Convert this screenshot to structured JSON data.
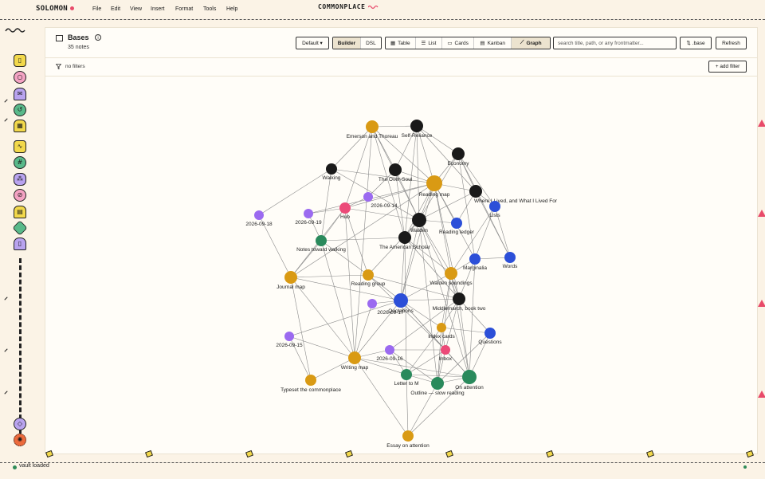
{
  "app": {
    "brand": "SOLOMON",
    "title": "COMMONPLACE",
    "menu": [
      "File",
      "Edit",
      "View",
      "Insert",
      "Format",
      "Tools",
      "Help"
    ]
  },
  "rail": {
    "icons": [
      "note-icon",
      "search-icon",
      "inbox-icon",
      "history-icon",
      "calendar-icon",
      "activity-icon",
      "grid-icon",
      "graph-icon",
      "tag-icon",
      "archive-icon",
      "label-icon",
      "book-icon",
      "shield-icon",
      "settings-icon"
    ]
  },
  "header": {
    "title": "Bases",
    "subtitle": "35 notes",
    "view_select": "Default ▾",
    "modes": [
      "Builder",
      "DSL"
    ],
    "views": [
      "Table",
      "List",
      "Cards",
      "Kanban",
      "Graph"
    ],
    "search_placeholder": "search title, path, or any frontmatter...",
    "base_button": "⇅ .base",
    "refresh_button": "Refresh"
  },
  "filter": {
    "label": "no filters",
    "add_label": "+ add filter"
  },
  "status": {
    "text": "vault loaded"
  },
  "colors": {
    "black": "#1a1a1a",
    "orange": "#d99a14",
    "blue": "#2c4fd8",
    "green": "#2a8a5c",
    "purple": "#9b6af0",
    "pink": "#ec4a78",
    "accent": "#e84a6a"
  },
  "graph": {
    "nodes": [
      {
        "id": "emerson",
        "label": "Emerson and Thoreau",
        "type": "orange"
      },
      {
        "id": "selfreliance",
        "label": "Self-Reliance",
        "type": "black"
      },
      {
        "id": "economy",
        "label": "Economy",
        "type": "black"
      },
      {
        "id": "walking",
        "label": "Walking",
        "type": "black"
      },
      {
        "id": "overSoul",
        "label": "The Over-Soul",
        "type": "black"
      },
      {
        "id": "readingmap",
        "label": "Reading map",
        "type": "orange"
      },
      {
        "id": "where",
        "label": "Where I Lived, and What I Lived For",
        "type": "black"
      },
      {
        "id": "d0914",
        "label": "2026-09-14",
        "type": "purple"
      },
      {
        "id": "hub",
        "label": "Hub",
        "type": "pink"
      },
      {
        "id": "d0919",
        "label": "2026-09-19",
        "type": "purple"
      },
      {
        "id": "d0918",
        "label": "2026-09-18",
        "type": "purple"
      },
      {
        "id": "lists",
        "label": "Lists",
        "type": "blue"
      },
      {
        "id": "walden",
        "label": "Walden",
        "type": "black"
      },
      {
        "id": "readingledger",
        "label": "Reading ledger",
        "type": "blue"
      },
      {
        "id": "americanscholar",
        "label": "The American Scholar",
        "type": "black"
      },
      {
        "id": "notestoward",
        "label": "Notes toward walking",
        "type": "green"
      },
      {
        "id": "marginalia",
        "label": "Marginalia",
        "type": "blue"
      },
      {
        "id": "words",
        "label": "Words",
        "type": "blue"
      },
      {
        "id": "journalmap",
        "label": "Journal map",
        "type": "orange"
      },
      {
        "id": "readinggroup",
        "label": "Reading group",
        "type": "orange"
      },
      {
        "id": "waldensoundings",
        "label": "Walden soundings",
        "type": "orange"
      },
      {
        "id": "middlemarch",
        "label": "Middlemarch, book two",
        "type": "black"
      },
      {
        "id": "d0917",
        "label": "2026-09-17",
        "type": "purple"
      },
      {
        "id": "quotations",
        "label": "Quotations",
        "type": "blue"
      },
      {
        "id": "indexcards",
        "label": "Index cards",
        "type": "orange"
      },
      {
        "id": "questions",
        "label": "Questions",
        "type": "blue"
      },
      {
        "id": "d0915",
        "label": "2026-09-15",
        "type": "purple"
      },
      {
        "id": "inbox",
        "label": "Inbox",
        "type": "pink"
      },
      {
        "id": "writingmap",
        "label": "Writing map",
        "type": "orange"
      },
      {
        "id": "d0916",
        "label": "2026-09-16",
        "type": "purple"
      },
      {
        "id": "letterto",
        "label": "Letter to M",
        "type": "green"
      },
      {
        "id": "onattention",
        "label": "On attention",
        "type": "green"
      },
      {
        "id": "outline",
        "label": "Outline — slow reading",
        "type": "green"
      },
      {
        "id": "typeset",
        "label": "Typeset the commonplace",
        "type": "orange"
      },
      {
        "id": "essay",
        "label": "Essay on attention",
        "type": "orange"
      }
    ],
    "edges": [
      [
        "emerson",
        "selfreliance"
      ],
      [
        "emerson",
        "walking"
      ],
      [
        "emerson",
        "overSoul"
      ],
      [
        "emerson",
        "readingmap"
      ],
      [
        "emerson",
        "walden"
      ],
      [
        "emerson",
        "americanscholar"
      ],
      [
        "emerson",
        "writingmap"
      ],
      [
        "emerson",
        "hub"
      ],
      [
        "selfreliance",
        "economy"
      ],
      [
        "selfreliance",
        "overSoul"
      ],
      [
        "selfreliance",
        "readingmap"
      ],
      [
        "selfreliance",
        "walden"
      ],
      [
        "selfreliance",
        "where"
      ],
      [
        "selfreliance",
        "americanscholar"
      ],
      [
        "economy",
        "readingmap"
      ],
      [
        "economy",
        "where"
      ],
      [
        "economy",
        "lists"
      ],
      [
        "economy",
        "walden"
      ],
      [
        "economy",
        "marginalia"
      ],
      [
        "economy",
        "words"
      ],
      [
        "walking",
        "notestoward"
      ],
      [
        "walking",
        "readingmap"
      ],
      [
        "walking",
        "d0918"
      ],
      [
        "walking",
        "walden"
      ],
      [
        "overSoul",
        "readingmap"
      ],
      [
        "overSoul",
        "walden"
      ],
      [
        "overSoul",
        "americanscholar"
      ],
      [
        "overSoul",
        "d0914"
      ],
      [
        "readingmap",
        "where"
      ],
      [
        "readingmap",
        "walden"
      ],
      [
        "readingmap",
        "americanscholar"
      ],
      [
        "readingmap",
        "readingledger"
      ],
      [
        "readingmap",
        "marginalia"
      ],
      [
        "readingmap",
        "waldensoundings"
      ],
      [
        "readingmap",
        "middlemarch"
      ],
      [
        "readingmap",
        "journalmap"
      ],
      [
        "readingmap",
        "d0919"
      ],
      [
        "readingmap",
        "hub"
      ],
      [
        "readingmap",
        "quotations"
      ],
      [
        "where",
        "walden"
      ],
      [
        "where",
        "lists"
      ],
      [
        "where",
        "readingledger"
      ],
      [
        "where",
        "words"
      ],
      [
        "hub",
        "d0919"
      ],
      [
        "hub",
        "d0914"
      ],
      [
        "hub",
        "notestoward"
      ],
      [
        "hub",
        "journalmap"
      ],
      [
        "hub",
        "readinggroup"
      ],
      [
        "hub",
        "writingmap"
      ],
      [
        "hub",
        "walden"
      ],
      [
        "d0918",
        "journalmap"
      ],
      [
        "d0919",
        "notestoward"
      ],
      [
        "walden",
        "americanscholar"
      ],
      [
        "walden",
        "readingledger"
      ],
      [
        "walden",
        "waldensoundings"
      ],
      [
        "walden",
        "quotations"
      ],
      [
        "walden",
        "middlemarch"
      ],
      [
        "walden",
        "readinggroup"
      ],
      [
        "walden",
        "onattention"
      ],
      [
        "walden",
        "outline"
      ],
      [
        "americanscholar",
        "notestoward"
      ],
      [
        "americanscholar",
        "quotations"
      ],
      [
        "americanscholar",
        "waldensoundings"
      ],
      [
        "americanscholar",
        "middlemarch"
      ],
      [
        "americanscholar",
        "letterto"
      ],
      [
        "notestoward",
        "journalmap"
      ],
      [
        "notestoward",
        "writingmap"
      ],
      [
        "notestoward",
        "readinggroup"
      ],
      [
        "marginalia",
        "words"
      ],
      [
        "marginalia",
        "lists"
      ],
      [
        "marginalia",
        "waldensoundings"
      ],
      [
        "marginalia",
        "middlemarch"
      ],
      [
        "marginalia",
        "onattention"
      ],
      [
        "lists",
        "words"
      ],
      [
        "lists",
        "waldensoundings"
      ],
      [
        "journalmap",
        "quotations"
      ],
      [
        "journalmap",
        "typeset"
      ],
      [
        "journalmap",
        "readinggroup"
      ],
      [
        "journalmap",
        "writingmap"
      ],
      [
        "readinggroup",
        "quotations"
      ],
      [
        "readinggroup",
        "inbox"
      ],
      [
        "readinggroup",
        "middlemarch"
      ],
      [
        "waldensoundings",
        "middlemarch"
      ],
      [
        "waldensoundings",
        "quotations"
      ],
      [
        "waldensoundings",
        "indexcards"
      ],
      [
        "waldensoundings",
        "onattention"
      ],
      [
        "waldensoundings",
        "outline"
      ],
      [
        "middlemarch",
        "quotations"
      ],
      [
        "middlemarch",
        "questions"
      ],
      [
        "middlemarch",
        "indexcards"
      ],
      [
        "middlemarch",
        "onattention"
      ],
      [
        "middlemarch",
        "inbox"
      ],
      [
        "middlemarch",
        "d0916"
      ],
      [
        "quotations",
        "d0917"
      ],
      [
        "quotations",
        "writingmap"
      ],
      [
        "quotations",
        "d0915"
      ],
      [
        "quotations",
        "indexcards"
      ],
      [
        "quotations",
        "onattention"
      ],
      [
        "quotations",
        "inbox"
      ],
      [
        "d0917",
        "writingmap"
      ],
      [
        "d0915",
        "writingmap"
      ],
      [
        "d0915",
        "typeset"
      ],
      [
        "indexcards",
        "questions"
      ],
      [
        "indexcards",
        "inbox"
      ],
      [
        "indexcards",
        "outline"
      ],
      [
        "indexcards",
        "letterto"
      ],
      [
        "inbox",
        "d0916"
      ],
      [
        "inbox",
        "onattention"
      ],
      [
        "inbox",
        "letterto"
      ],
      [
        "inbox",
        "outline"
      ],
      [
        "questions",
        "onattention"
      ],
      [
        "questions",
        "outline"
      ],
      [
        "writingmap",
        "d0916"
      ],
      [
        "writingmap",
        "letterto"
      ],
      [
        "writingmap",
        "essay"
      ],
      [
        "writingmap",
        "typeset"
      ],
      [
        "writingmap",
        "onattention"
      ],
      [
        "d0916",
        "letterto"
      ],
      [
        "d0916",
        "outline"
      ],
      [
        "letterto",
        "outline"
      ],
      [
        "letterto",
        "onattention"
      ],
      [
        "letterto",
        "essay"
      ],
      [
        "outline",
        "onattention"
      ],
      [
        "outline",
        "essay"
      ],
      [
        "onattention",
        "essay"
      ]
    ]
  }
}
